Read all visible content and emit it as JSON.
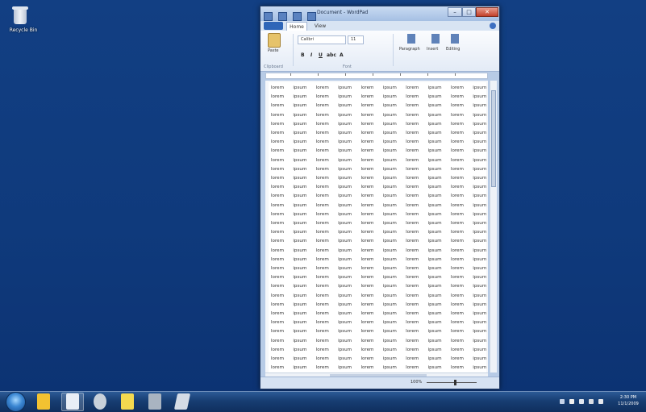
{
  "desktop": {
    "icons": [
      {
        "label": "Recycle Bin",
        "icon": "recycle-bin-icon"
      }
    ]
  },
  "wordpad": {
    "title": "Document - WordPad",
    "file_tab": "",
    "tabs": [
      "Home",
      "View"
    ],
    "ribbon": {
      "font_name": "Calibri",
      "font_size": "11",
      "paste_label": "Paste",
      "clipboard_group": "Clipboard",
      "font_group": "Font",
      "paragraph_label": "Paragraph",
      "insert_label": "Insert",
      "editing_label": "Editing"
    },
    "document": {
      "word": "lorem ipsum",
      "line_count": 32
    },
    "statusbar": {
      "zoom": "100%"
    }
  },
  "taskbar": {
    "pinned": [
      "start-orb",
      "explorer-icon",
      "wordpad-icon",
      "paint-icon",
      "sticky-notes-icon",
      "snipping-icon",
      "notepad-icon"
    ],
    "clock": {
      "time": "2:30 PM",
      "date": "11/1/2009"
    }
  }
}
